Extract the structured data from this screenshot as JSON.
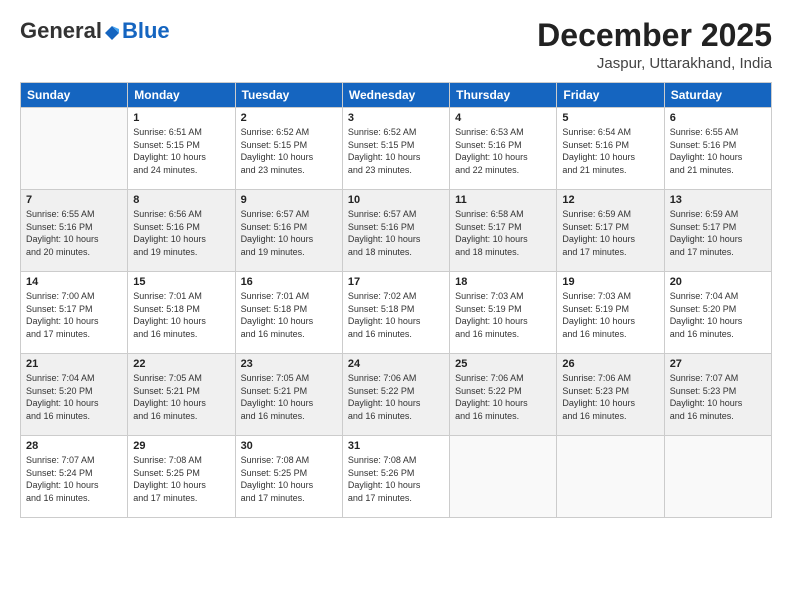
{
  "logo": {
    "general": "General",
    "blue": "Blue"
  },
  "header": {
    "month_year": "December 2025",
    "location": "Jaspur, Uttarakhand, India"
  },
  "weekdays": [
    "Sunday",
    "Monday",
    "Tuesday",
    "Wednesday",
    "Thursday",
    "Friday",
    "Saturday"
  ],
  "weeks": [
    [
      {
        "day": "",
        "info": ""
      },
      {
        "day": "1",
        "info": "Sunrise: 6:51 AM\nSunset: 5:15 PM\nDaylight: 10 hours\nand 24 minutes."
      },
      {
        "day": "2",
        "info": "Sunrise: 6:52 AM\nSunset: 5:15 PM\nDaylight: 10 hours\nand 23 minutes."
      },
      {
        "day": "3",
        "info": "Sunrise: 6:52 AM\nSunset: 5:15 PM\nDaylight: 10 hours\nand 23 minutes."
      },
      {
        "day": "4",
        "info": "Sunrise: 6:53 AM\nSunset: 5:16 PM\nDaylight: 10 hours\nand 22 minutes."
      },
      {
        "day": "5",
        "info": "Sunrise: 6:54 AM\nSunset: 5:16 PM\nDaylight: 10 hours\nand 21 minutes."
      },
      {
        "day": "6",
        "info": "Sunrise: 6:55 AM\nSunset: 5:16 PM\nDaylight: 10 hours\nand 21 minutes."
      }
    ],
    [
      {
        "day": "7",
        "info": "Sunrise: 6:55 AM\nSunset: 5:16 PM\nDaylight: 10 hours\nand 20 minutes."
      },
      {
        "day": "8",
        "info": "Sunrise: 6:56 AM\nSunset: 5:16 PM\nDaylight: 10 hours\nand 19 minutes."
      },
      {
        "day": "9",
        "info": "Sunrise: 6:57 AM\nSunset: 5:16 PM\nDaylight: 10 hours\nand 19 minutes."
      },
      {
        "day": "10",
        "info": "Sunrise: 6:57 AM\nSunset: 5:16 PM\nDaylight: 10 hours\nand 18 minutes."
      },
      {
        "day": "11",
        "info": "Sunrise: 6:58 AM\nSunset: 5:17 PM\nDaylight: 10 hours\nand 18 minutes."
      },
      {
        "day": "12",
        "info": "Sunrise: 6:59 AM\nSunset: 5:17 PM\nDaylight: 10 hours\nand 17 minutes."
      },
      {
        "day": "13",
        "info": "Sunrise: 6:59 AM\nSunset: 5:17 PM\nDaylight: 10 hours\nand 17 minutes."
      }
    ],
    [
      {
        "day": "14",
        "info": "Sunrise: 7:00 AM\nSunset: 5:17 PM\nDaylight: 10 hours\nand 17 minutes."
      },
      {
        "day": "15",
        "info": "Sunrise: 7:01 AM\nSunset: 5:18 PM\nDaylight: 10 hours\nand 16 minutes."
      },
      {
        "day": "16",
        "info": "Sunrise: 7:01 AM\nSunset: 5:18 PM\nDaylight: 10 hours\nand 16 minutes."
      },
      {
        "day": "17",
        "info": "Sunrise: 7:02 AM\nSunset: 5:18 PM\nDaylight: 10 hours\nand 16 minutes."
      },
      {
        "day": "18",
        "info": "Sunrise: 7:03 AM\nSunset: 5:19 PM\nDaylight: 10 hours\nand 16 minutes."
      },
      {
        "day": "19",
        "info": "Sunrise: 7:03 AM\nSunset: 5:19 PM\nDaylight: 10 hours\nand 16 minutes."
      },
      {
        "day": "20",
        "info": "Sunrise: 7:04 AM\nSunset: 5:20 PM\nDaylight: 10 hours\nand 16 minutes."
      }
    ],
    [
      {
        "day": "21",
        "info": "Sunrise: 7:04 AM\nSunset: 5:20 PM\nDaylight: 10 hours\nand 16 minutes."
      },
      {
        "day": "22",
        "info": "Sunrise: 7:05 AM\nSunset: 5:21 PM\nDaylight: 10 hours\nand 16 minutes."
      },
      {
        "day": "23",
        "info": "Sunrise: 7:05 AM\nSunset: 5:21 PM\nDaylight: 10 hours\nand 16 minutes."
      },
      {
        "day": "24",
        "info": "Sunrise: 7:06 AM\nSunset: 5:22 PM\nDaylight: 10 hours\nand 16 minutes."
      },
      {
        "day": "25",
        "info": "Sunrise: 7:06 AM\nSunset: 5:22 PM\nDaylight: 10 hours\nand 16 minutes."
      },
      {
        "day": "26",
        "info": "Sunrise: 7:06 AM\nSunset: 5:23 PM\nDaylight: 10 hours\nand 16 minutes."
      },
      {
        "day": "27",
        "info": "Sunrise: 7:07 AM\nSunset: 5:23 PM\nDaylight: 10 hours\nand 16 minutes."
      }
    ],
    [
      {
        "day": "28",
        "info": "Sunrise: 7:07 AM\nSunset: 5:24 PM\nDaylight: 10 hours\nand 16 minutes."
      },
      {
        "day": "29",
        "info": "Sunrise: 7:08 AM\nSunset: 5:25 PM\nDaylight: 10 hours\nand 17 minutes."
      },
      {
        "day": "30",
        "info": "Sunrise: 7:08 AM\nSunset: 5:25 PM\nDaylight: 10 hours\nand 17 minutes."
      },
      {
        "day": "31",
        "info": "Sunrise: 7:08 AM\nSunset: 5:26 PM\nDaylight: 10 hours\nand 17 minutes."
      },
      {
        "day": "",
        "info": ""
      },
      {
        "day": "",
        "info": ""
      },
      {
        "day": "",
        "info": ""
      }
    ]
  ]
}
